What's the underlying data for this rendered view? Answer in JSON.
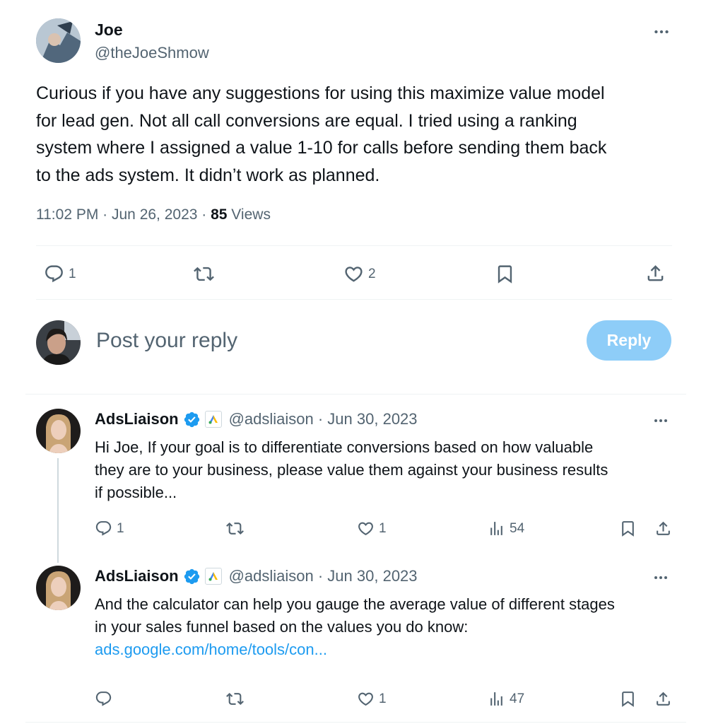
{
  "main_tweet": {
    "author_name": "Joe",
    "handle": "@theJoeShmow",
    "text_lines": [
      "Curious if you have any suggestions for using this maximize value model",
      "for lead gen. Not all call conversions are equal. I tried using a ranking",
      "system where I assigned a value 1-10 for calls before sending them back",
      "to the ads system. It didn’t work as planned."
    ],
    "meta": {
      "time": "11:02 PM",
      "sep1": " · ",
      "date": "Jun 26, 2023",
      "sep2": " · ",
      "views_count": "85",
      "views_label": " Views"
    },
    "actions": {
      "reply_count": "1",
      "like_count": "2"
    }
  },
  "composer": {
    "placeholder": "Post your reply",
    "reply_button": "Reply"
  },
  "replies": [
    {
      "author_name": "AdsLiaison",
      "handle_date": "@adsliaison · Jun 30, 2023",
      "text_lines": [
        "Hi Joe, If your goal is to differentiate conversions based on how valuable",
        "they are to your business, please value them against your business results",
        "if possible..."
      ],
      "reply_count": "1",
      "like_count": "1",
      "views_count": "54"
    },
    {
      "author_name": "AdsLiaison",
      "handle_date": "@adsliaison · Jun 30, 2023",
      "text_lines": [
        "And the calculator can help you gauge the average value of different stages",
        "in your sales funnel based on the values you do know:"
      ],
      "link": "ads.google.com/home/tools/con...",
      "reply_count": "",
      "like_count": "1",
      "views_count": "47"
    }
  ],
  "colors": {
    "accent": "#1d9bf0",
    "reply_button_disabled": "#8ecdf8",
    "muted_text": "#536471",
    "divider": "#eff3f4"
  },
  "icons": {
    "more": "more-icon",
    "reply": "reply-icon",
    "repost": "repost-icon",
    "like": "like-icon",
    "bookmark": "bookmark-icon",
    "share": "share-icon",
    "views": "views-icon",
    "verified": "verified-badge-icon",
    "affiliate": "google-ads-affiliate-icon"
  }
}
